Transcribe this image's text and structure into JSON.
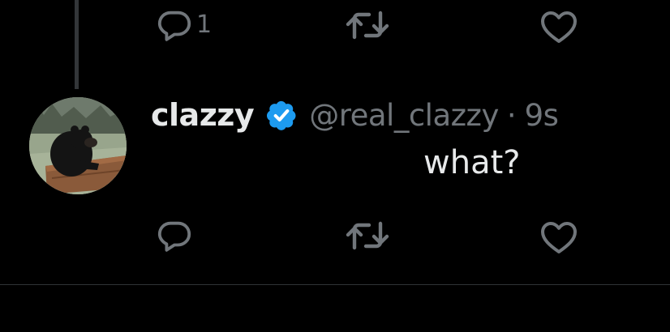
{
  "previous_tweet": {
    "actions": {
      "reply_count": "1",
      "repost_count": "",
      "like_count": ""
    }
  },
  "tweet": {
    "avatar_icon": "bear-photo-avatar",
    "display_name": "clazzy",
    "verified_icon": "verified-badge-icon",
    "handle": "@real_clazzy",
    "separator": "·",
    "timestamp": "9s",
    "text": "what?",
    "actions": {
      "reply_count": "",
      "repost_count": "",
      "like_count": ""
    }
  },
  "colors": {
    "background": "#000000",
    "primary_text": "#e7e9ea",
    "secondary_text": "#71767b",
    "verified_blue": "#1d9bf0",
    "divider": "#2f3336"
  }
}
